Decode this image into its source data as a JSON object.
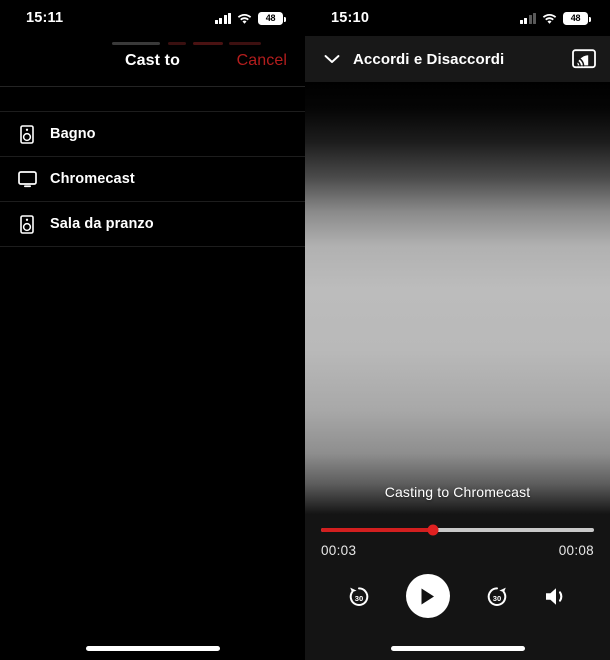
{
  "left_screen": {
    "status_bar": {
      "time": "15:11",
      "battery_level": "48",
      "icons": [
        "cellular-signal-icon",
        "wifi-icon",
        "battery-icon"
      ]
    },
    "sheet": {
      "title": "Cast to",
      "cancel_label": "Cancel",
      "cancel_color": "#cc2222",
      "devices": [
        {
          "label": "Bagno",
          "icon": "speaker-icon"
        },
        {
          "label": "Chromecast",
          "icon": "tv-icon"
        },
        {
          "label": "Sala da pranzo",
          "icon": "speaker-icon"
        }
      ]
    },
    "home_indicator": "home-indicator"
  },
  "right_screen": {
    "status_bar": {
      "time": "15:10",
      "battery_level": "48",
      "icons": [
        "cellular-signal-icon",
        "wifi-icon",
        "battery-icon"
      ]
    },
    "player": {
      "collapse_icon": "chevron-down-icon",
      "title": "Accordi e Disaccordi",
      "cast_icon": "cast-connected-icon",
      "casting_status": "Casting to Chromecast",
      "progress_percent": 41,
      "progress_color": "#d21f1f",
      "track_color": "#c9c9c9",
      "current_time": "00:03",
      "total_time": "00:08",
      "controls": [
        {
          "name": "rewind-30-button",
          "label": "30"
        },
        {
          "name": "play-button",
          "label": "Play"
        },
        {
          "name": "forward-30-button",
          "label": "30"
        },
        {
          "name": "volume-button",
          "label": "Volume"
        }
      ]
    },
    "home_indicator": "home-indicator"
  }
}
